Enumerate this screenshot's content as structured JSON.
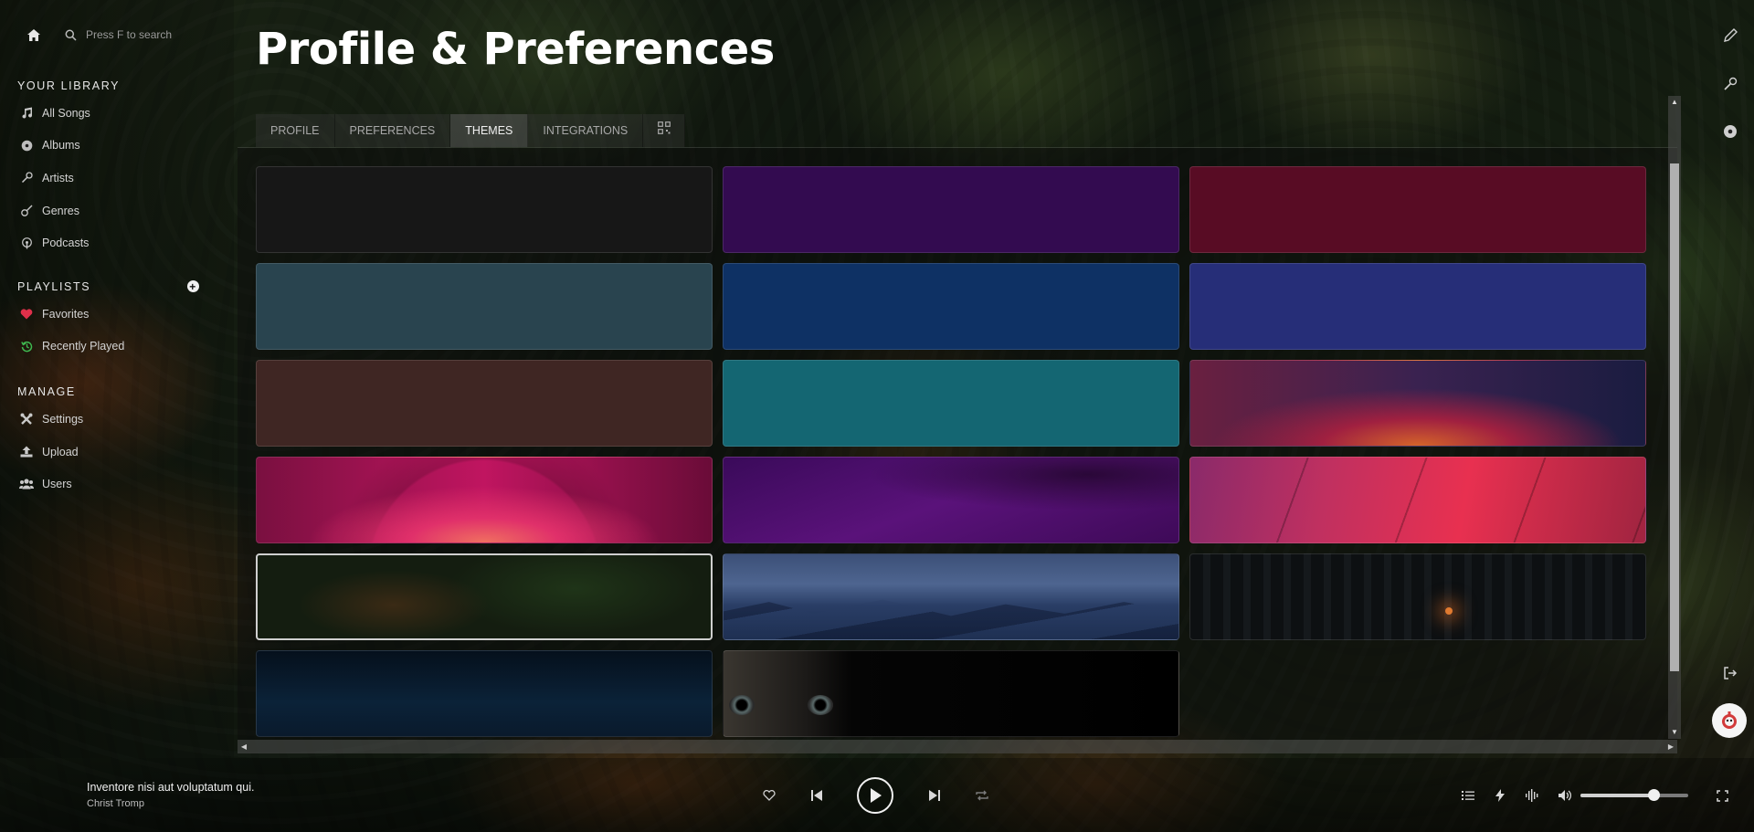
{
  "search": {
    "placeholder": "Press F to search"
  },
  "sidebar": {
    "library_title": "YOUR LIBRARY",
    "library_items": [
      {
        "label": "All Songs",
        "icon": "music-note-icon"
      },
      {
        "label": "Albums",
        "icon": "disc-icon"
      },
      {
        "label": "Artists",
        "icon": "microphone-icon"
      },
      {
        "label": "Genres",
        "icon": "guitar-icon"
      },
      {
        "label": "Podcasts",
        "icon": "podcast-icon"
      }
    ],
    "playlists_title": "PLAYLISTS",
    "playlist_items": [
      {
        "label": "Favorites",
        "icon": "heart-icon",
        "color": "#e0304a"
      },
      {
        "label": "Recently Played",
        "icon": "history-icon",
        "color": "#3fb950"
      }
    ],
    "manage_title": "MANAGE",
    "manage_items": [
      {
        "label": "Settings",
        "icon": "tools-icon"
      },
      {
        "label": "Upload",
        "icon": "upload-icon"
      },
      {
        "label": "Users",
        "icon": "users-icon"
      }
    ]
  },
  "main": {
    "title": "Profile & Preferences",
    "tabs": [
      {
        "label": "PROFILE",
        "active": false
      },
      {
        "label": "PREFERENCES",
        "active": false
      },
      {
        "label": "THEMES",
        "active": true
      },
      {
        "label": "INTEGRATIONS",
        "active": false
      },
      {
        "label": "",
        "icon": "qr-code-icon",
        "active": false
      }
    ],
    "themes": [
      {
        "id": "dark",
        "color": "#171717"
      },
      {
        "id": "violet",
        "color": "#330b50"
      },
      {
        "id": "maroon",
        "color": "#580c24"
      },
      {
        "id": "slate",
        "color": "#29444f"
      },
      {
        "id": "navy",
        "color": "#0e3164"
      },
      {
        "id": "indigo",
        "color": "#262e78"
      },
      {
        "id": "brown",
        "color": "#3f2623"
      },
      {
        "id": "teal",
        "color": "#146672"
      },
      {
        "id": "sunset",
        "color": "gradient"
      },
      {
        "id": "pink",
        "color": "gradient"
      },
      {
        "id": "purplewave",
        "color": "gradient"
      },
      {
        "id": "redwall",
        "color": "gradient"
      },
      {
        "id": "jungle",
        "color": "image",
        "selected": true
      },
      {
        "id": "mountains",
        "color": "image"
      },
      {
        "id": "forest",
        "color": "image"
      },
      {
        "id": "ocean",
        "color": "image"
      },
      {
        "id": "cat",
        "color": "image"
      }
    ]
  },
  "right_rail": [
    "pencil-icon",
    "microphone-icon",
    "disc-icon",
    "logout-icon"
  ],
  "player": {
    "song_title": "Inventore nisi aut voluptatum qui.",
    "artist": "Christ Tromp",
    "volume": 0.68,
    "controls": [
      "heart-icon",
      "previous-icon",
      "play-icon",
      "next-icon",
      "repeat-icon"
    ],
    "extras": [
      "queue-icon",
      "lightning-icon",
      "equalizer-icon",
      "volume-icon",
      "fullscreen-icon"
    ]
  }
}
